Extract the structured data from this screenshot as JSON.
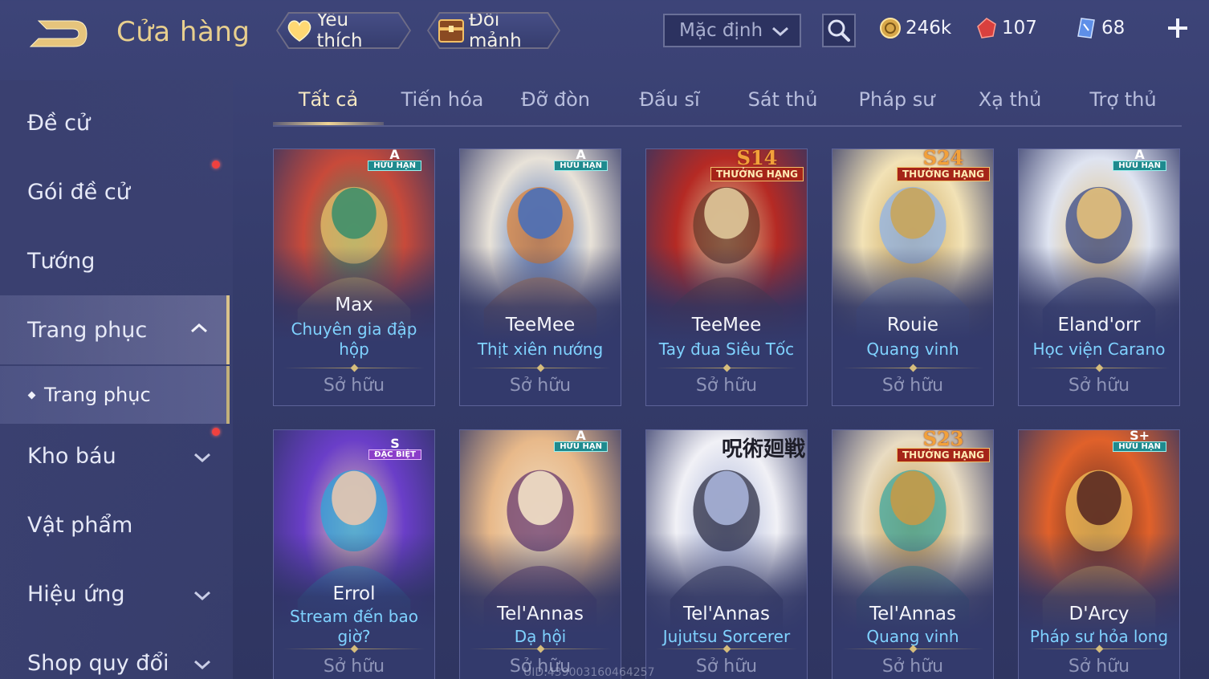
{
  "header": {
    "title": "Cửa hàng",
    "favorites_label": "Yêu thích",
    "exchange_label": "Đổi mảnh",
    "sort_value": "Mặc định",
    "currencies": [
      {
        "name": "gold",
        "value": "246k",
        "color": "#e2b955"
      },
      {
        "name": "ruby",
        "value": "107",
        "color": "#e2534e"
      },
      {
        "name": "voucher",
        "value": "68",
        "color": "#7fb4ff"
      }
    ]
  },
  "sidebar": {
    "items": [
      {
        "label": "Đề cử"
      },
      {
        "label": "Gói đề cử",
        "notify": true
      },
      {
        "label": "Tướng"
      },
      {
        "label": "Trang phục",
        "expanded": true,
        "active": true
      },
      {
        "label": "Trang phục",
        "sub": true
      },
      {
        "label": "Kho báu",
        "notify": true
      },
      {
        "label": "Vật phẩm"
      },
      {
        "label": "Hiệu ứng"
      },
      {
        "label": "Shop quy đổi"
      }
    ]
  },
  "tabs": [
    "Tất cả",
    "Tiến hóa",
    "Đỡ đòn",
    "Đấu sĩ",
    "Sát thủ",
    "Pháp sư",
    "Xạ thủ",
    "Trợ thủ"
  ],
  "active_tab": "Tất cả",
  "cards": [
    {
      "hero": "Max",
      "skin": "Chuyên gia đập",
      "skin2": "hộp",
      "status": "Sở hữu",
      "badge": {
        "type": "teal",
        "grade": "A",
        "text": "HỮU HẠN"
      },
      "colors": [
        "#c84a3a",
        "#e9c26a",
        "#3f8f6a"
      ]
    },
    {
      "hero": "TeeMee",
      "skin": "Thịt xiên nướng",
      "status": "Sở hữu",
      "badge": {
        "type": "teal",
        "grade": "A",
        "text": "HỮU HẠN"
      },
      "colors": [
        "#e8e2d8",
        "#d9833c",
        "#4a6fb8"
      ]
    },
    {
      "hero": "TeeMee",
      "skin": "Tay đua Siêu Tốc",
      "status": "Sở hữu",
      "badge": {
        "type": "ranked",
        "grade": "S14",
        "text": "THƯỞNG HẠNG"
      },
      "colors": [
        "#b52a24",
        "#6b3a2a",
        "#e0c89a"
      ]
    },
    {
      "hero": "Rouie",
      "skin": "Quang vinh",
      "status": "Sở hữu",
      "badge": {
        "type": "ranked",
        "grade": "S24",
        "text": "THƯỞNG HẠNG"
      },
      "colors": [
        "#f2e2b6",
        "#8fb3e8",
        "#c9a55a"
      ]
    },
    {
      "hero": "Eland'orr",
      "skin": "Học viện Carano",
      "status": "Sở hữu",
      "badge": {
        "type": "teal",
        "grade": "A",
        "text": "HỮU HẠN"
      },
      "colors": [
        "#dfe4f1",
        "#3a4a86",
        "#e3c07a"
      ]
    },
    {
      "hero": "Errol",
      "skin": "Stream đến bao",
      "skin2": "giờ?",
      "status": "Sở hữu",
      "badge": {
        "type": "purple",
        "grade": "S",
        "text": "ĐẶC BIỆT"
      },
      "colors": [
        "#6a3ec8",
        "#2fa6d8",
        "#e6c6b0"
      ]
    },
    {
      "hero": "Tel'Annas",
      "skin": "Dạ hội",
      "status": "Sở hữu",
      "badge": {
        "type": "teal",
        "grade": "A",
        "text": "HỮU HẠN"
      },
      "colors": [
        "#e8b98a",
        "#6a3a6e",
        "#f2e1c6"
      ]
    },
    {
      "hero": "Tel'Annas",
      "skin": "Jujutsu Sorcerer",
      "status": "Sở hữu",
      "badge": {
        "type": "kanji",
        "grade": "呪術廻戦",
        "text": ""
      },
      "colors": [
        "#f1f1f6",
        "#2c2d44",
        "#a7b2d8"
      ]
    },
    {
      "hero": "Tel'Annas",
      "skin": "Quang vinh",
      "status": "Sở hữu",
      "badge": {
        "type": "ranked",
        "grade": "S23",
        "text": "THƯỞNG HẠNG"
      },
      "colors": [
        "#e9dcc2",
        "#3fa8a0",
        "#c49a48"
      ]
    },
    {
      "hero": "D'Arcy",
      "skin": "Pháp sư hỏa long",
      "status": "Sở hữu",
      "badge": {
        "type": "teal",
        "grade": "S+",
        "text": "HỮU HẠN"
      },
      "colors": [
        "#e0612a",
        "#f2c25a",
        "#5a2a22"
      ]
    }
  ],
  "uid_text": "UID:439003160464257"
}
